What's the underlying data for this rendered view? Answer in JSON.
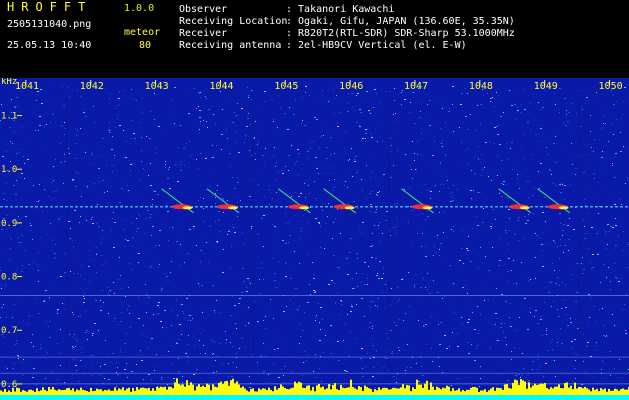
{
  "app": {
    "logo": "HROFFT",
    "version": "1.0.0",
    "filename": "2505131040.png",
    "datetime": "25.05.13 10:40",
    "meteor_label": "meteor",
    "meteor_count": "80"
  },
  "info": {
    "rows": [
      {
        "label": "Observer",
        "value": ": Takanori Kawachi"
      },
      {
        "label": "Receiving Location",
        "value": ": Ogaki, Gifu, JAPAN (136.60E, 35.35N)"
      },
      {
        "label": "Receiver",
        "value": ": R820T2(RTL-SDR) SDR-Sharp 53.1000MHz"
      },
      {
        "label": "Receiving antenna",
        "value": ": 2el-HB9CV Vertical (el. E-W)"
      }
    ]
  },
  "chart_data": {
    "type": "heatmap",
    "y_unit": "kHz",
    "x_ticks": [
      "1041",
      "1042",
      "1043",
      "1044",
      "1045",
      "1046",
      "1047",
      "1048",
      "1049",
      "1050"
    ],
    "x_range": [
      1040.6,
      1050.3
    ],
    "y_ticks": [
      "1.1",
      "1.0",
      "0.9",
      "0.8",
      "0.7",
      "0.6"
    ],
    "y_range": [
      0.57,
      1.17
    ],
    "carrier_khz": 0.93,
    "meteor_echoes_x": [
      1043.4,
      1044.1,
      1045.2,
      1045.9,
      1047.1,
      1048.6,
      1049.2
    ],
    "colors": {
      "background": "#0a1aa8",
      "noise_high": "#3ab8ff",
      "echo": "#ff3030",
      "axis": "#ffff33",
      "level_bars": "#ffff00",
      "baseline": "#00ffff"
    }
  }
}
